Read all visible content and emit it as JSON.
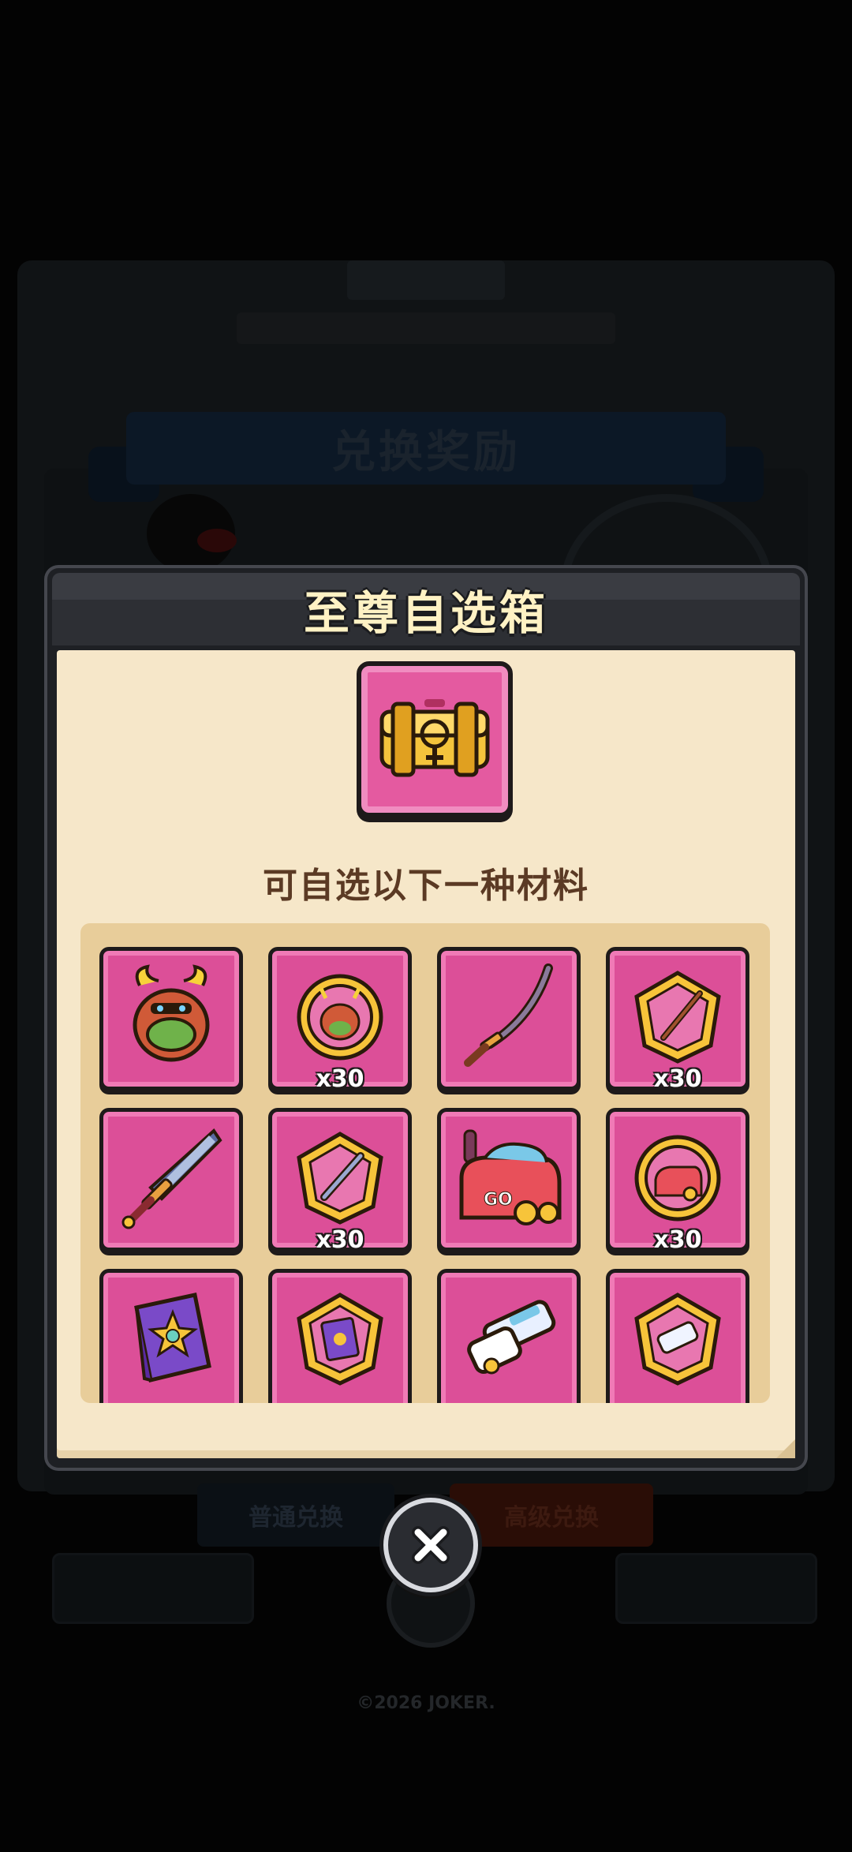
{
  "background": {
    "panel_title": "",
    "banner_title": "兑换奖励",
    "tabs": {
      "normal_label": "普通兑换",
      "advanced_label": "高级兑换"
    },
    "copyright": "©2026 JOKER."
  },
  "dialog": {
    "title": "至尊自选箱",
    "chest_icon": "golden-chest-icon",
    "subtitle": "可自选以下一种材料",
    "items": [
      {
        "icon": "reindeer-pet-icon",
        "qty": ""
      },
      {
        "icon": "reindeer-pet-shard-icon",
        "qty": "x30"
      },
      {
        "icon": "katana-weapon-icon",
        "qty": ""
      },
      {
        "icon": "katana-shard-icon",
        "qty": "x30"
      },
      {
        "icon": "greatsword-weapon-icon",
        "qty": ""
      },
      {
        "icon": "greatsword-shard-icon",
        "qty": "x30"
      },
      {
        "icon": "go-kart-mount-icon",
        "qty": ""
      },
      {
        "icon": "go-kart-shard-icon",
        "qty": "x30"
      },
      {
        "icon": "spellbook-icon",
        "qty": ""
      },
      {
        "icon": "spellbook-shard-icon",
        "qty": ""
      },
      {
        "icon": "blaster-gun-icon",
        "qty": ""
      },
      {
        "icon": "blaster-shard-icon",
        "qty": ""
      }
    ]
  },
  "close_button": {
    "icon": "close-icon"
  },
  "colors": {
    "item_bg": "#dc4f98",
    "dialog_body": "#f6e7c9",
    "grid_panel": "#e8cd9a",
    "title_text": "#fff2c4",
    "subtitle_text": "#5b3a24"
  }
}
